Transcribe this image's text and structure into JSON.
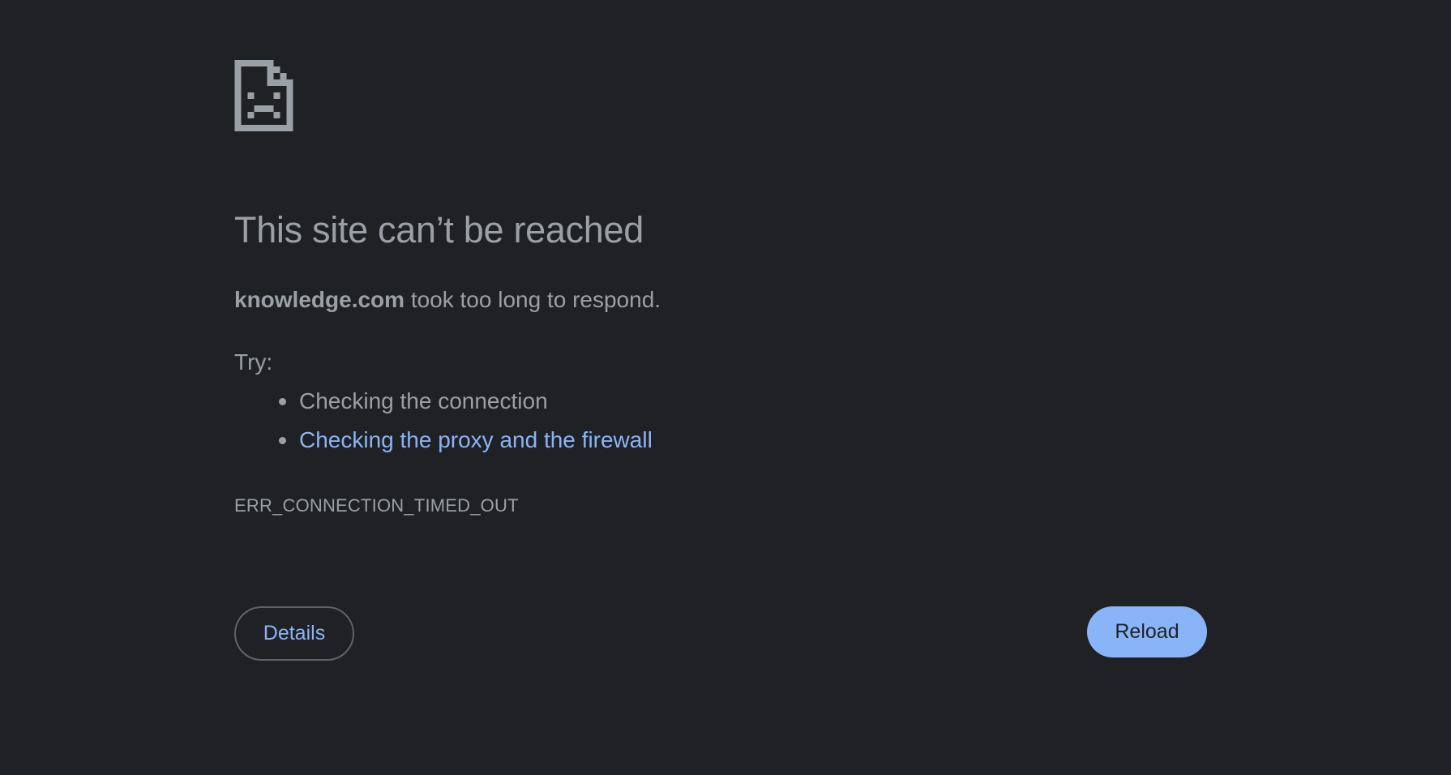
{
  "icon": {
    "name": "sad-document-icon",
    "color": "#9aa0a6"
  },
  "title": "This site can’t be reached",
  "summary": {
    "host": "knowledge.com",
    "text": " took too long to respond."
  },
  "try_label": "Try:",
  "suggestions": [
    {
      "text": "Checking the connection",
      "is_link": false
    },
    {
      "text": "Checking the proxy and the firewall",
      "is_link": true
    }
  ],
  "error_code": "ERR_CONNECTION_TIMED_OUT",
  "buttons": {
    "details": "Details",
    "reload": "Reload"
  },
  "colors": {
    "background": "#202124",
    "text": "#9aa0a6",
    "link": "#8ab4f8",
    "button_primary": "#8ab4f8",
    "button_border": "#5f6368"
  }
}
